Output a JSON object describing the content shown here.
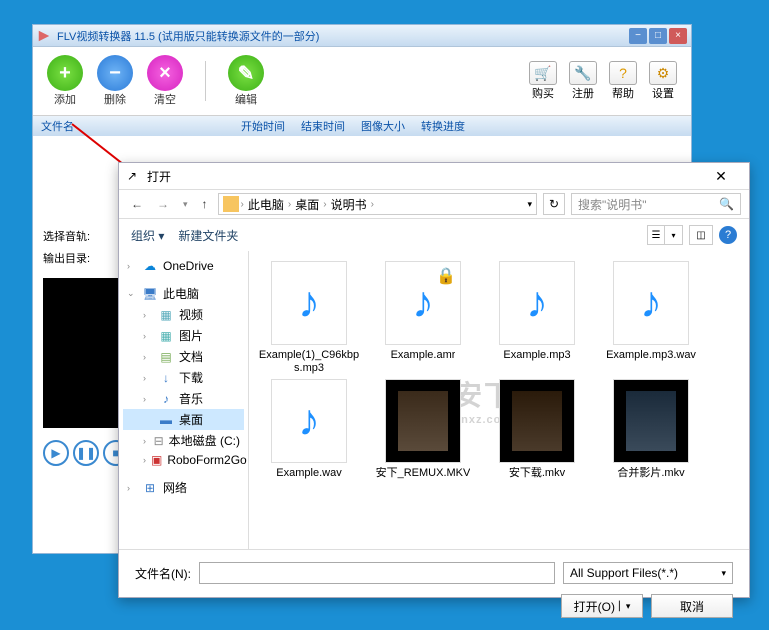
{
  "main": {
    "title": "FLV视频转换器 11.5 (试用版只能转换源文件的一部分)",
    "toolbar": {
      "add": "添加",
      "del": "删除",
      "clear": "清空",
      "edit": "编辑",
      "buy": "购买",
      "reg": "注册",
      "help": "帮助",
      "settings": "设置"
    },
    "columns": {
      "filename": "文件名",
      "start": "开始时间",
      "end": "结束时间",
      "size": "图像大小",
      "progress": "转换进度"
    },
    "status": {
      "track": "选择音轨:",
      "outdir": "输出目录:"
    }
  },
  "dialog": {
    "title": "打开",
    "breadcrumb": [
      "此电脑",
      "桌面",
      "说明书"
    ],
    "search_placeholder": "搜索\"说明书\"",
    "organize": "组织",
    "new_folder": "新建文件夹",
    "tree": {
      "onedrive": "OneDrive",
      "thispc": "此电脑",
      "video": "视频",
      "pictures": "图片",
      "documents": "文档",
      "downloads": "下载",
      "music": "音乐",
      "desktop": "桌面",
      "cdrive": "本地磁盘 (C:)",
      "roboform": "RoboForm2Go",
      "network": "网络"
    },
    "files": [
      {
        "name": "Example(1)_C96kbps.mp3",
        "type": "audio"
      },
      {
        "name": "Example.amr",
        "type": "audio_locked"
      },
      {
        "name": "Example.mp3",
        "type": "audio"
      },
      {
        "name": "Example.mp3.wav",
        "type": "audio"
      },
      {
        "name": "Example.wav",
        "type": "audio"
      },
      {
        "name": "安下_REMUX.MKV",
        "type": "video"
      },
      {
        "name": "安下载.mkv",
        "type": "video"
      },
      {
        "name": "合并影片.mkv",
        "type": "video"
      }
    ],
    "filename_label": "文件名(N):",
    "filter": "All Support Files(*.*)",
    "open_btn": "打开(O)",
    "cancel_btn": "取消"
  },
  "watermark": {
    "main": "安下载",
    "sub": "anxz.com"
  }
}
